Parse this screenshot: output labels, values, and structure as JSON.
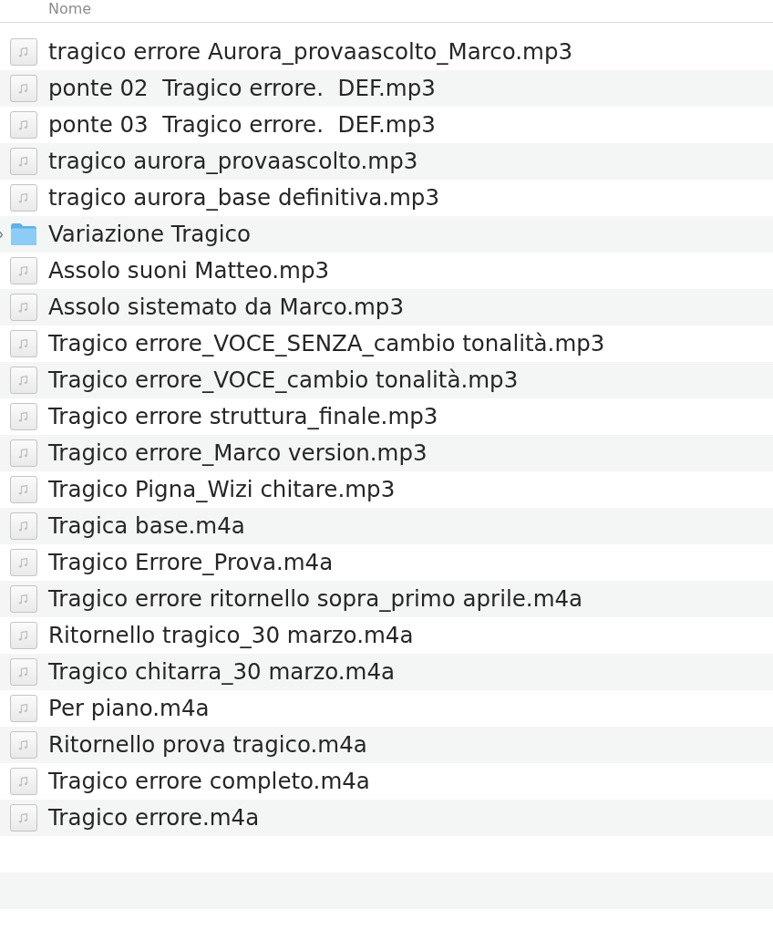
{
  "header": {
    "column_label": "Nome"
  },
  "rows": [
    {
      "kind": "audio",
      "name": "tragico errore Aurora_provaascolto_Marco.mp3"
    },
    {
      "kind": "audio",
      "name": "ponte 02  Tragico errore.  DEF.mp3"
    },
    {
      "kind": "audio",
      "name": "ponte 03  Tragico errore.  DEF.mp3"
    },
    {
      "kind": "audio",
      "name": "tragico aurora_provaascolto.mp3"
    },
    {
      "kind": "audio",
      "name": "tragico aurora_base definitiva.mp3"
    },
    {
      "kind": "folder",
      "name": "Variazione Tragico"
    },
    {
      "kind": "audio",
      "name": "Assolo suoni Matteo.mp3"
    },
    {
      "kind": "audio",
      "name": "Assolo sistemato da Marco.mp3"
    },
    {
      "kind": "audio",
      "name": "Tragico errore_VOCE_SENZA_cambio tonalità.mp3"
    },
    {
      "kind": "audio",
      "name": "Tragico errore_VOCE_cambio tonalità.mp3"
    },
    {
      "kind": "audio",
      "name": "Tragico errore struttura_finale.mp3"
    },
    {
      "kind": "audio",
      "name": "Tragico errore_Marco version.mp3"
    },
    {
      "kind": "audio",
      "name": "Tragico Pigna_Wizi chitare.mp3"
    },
    {
      "kind": "audio",
      "name": "Tragica base.m4a"
    },
    {
      "kind": "audio",
      "name": "Tragico Errore_Prova.m4a"
    },
    {
      "kind": "audio",
      "name": "Tragico errore ritornello sopra_primo aprile.m4a"
    },
    {
      "kind": "audio",
      "name": "Ritornello tragico_30 marzo.m4a"
    },
    {
      "kind": "audio",
      "name": "Tragico chitarra_30 marzo.m4a"
    },
    {
      "kind": "audio",
      "name": "Per piano.m4a"
    },
    {
      "kind": "audio",
      "name": "Ritornello prova tragico.m4a"
    },
    {
      "kind": "audio",
      "name": "Tragico errore completo.m4a"
    },
    {
      "kind": "audio",
      "name": "Tragico errore.m4a"
    }
  ]
}
